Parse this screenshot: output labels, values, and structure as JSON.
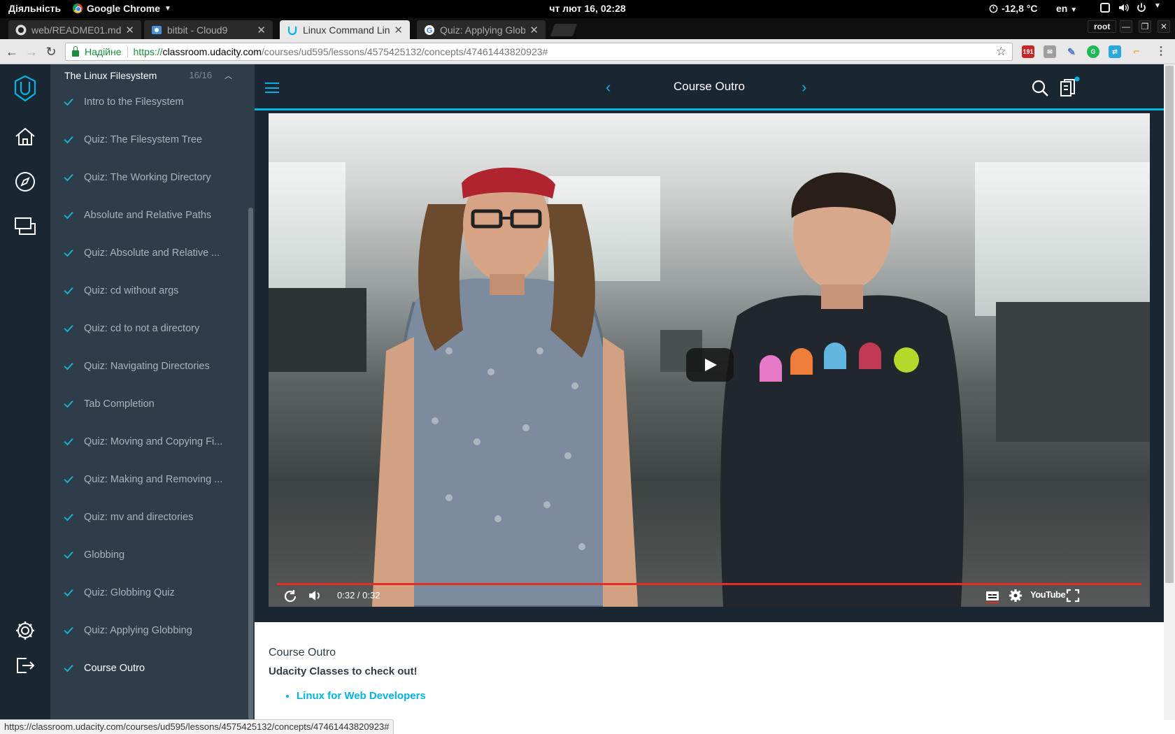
{
  "system_bar": {
    "activities": "Діяльність",
    "app_name": "Google Chrome",
    "clock": "чт лют 16, 02:28",
    "weather": "-12,8 °C",
    "language": "en"
  },
  "browser": {
    "tabs": [
      {
        "title": "web/README01.md",
        "favicon": "github-icon"
      },
      {
        "title": "bitbit - Cloud9",
        "favicon": "cloud9-icon"
      },
      {
        "title": "Linux Command Line",
        "favicon": "udacity-icon",
        "active": true
      },
      {
        "title": "Quiz: Applying Globbing",
        "favicon": "google-icon"
      }
    ],
    "user": "root",
    "secure_label": "Надійне",
    "url_scheme": "https://",
    "url_host": "classroom.udacity.com",
    "url_path": "/courses/ud595/lessons/4575425132/concepts/47461443820923#",
    "extension_badge": "191",
    "status_url": "https://classroom.udacity.com/courses/ud595/lessons/4575425132/concepts/47461443820923#"
  },
  "sidebar": {
    "lesson_title": "The Linux Filesystem",
    "progress": "16/16",
    "items": [
      {
        "label": "Intro to the Filesystem"
      },
      {
        "label": "Quiz: The Filesystem Tree"
      },
      {
        "label": "Quiz: The Working Directory"
      },
      {
        "label": "Absolute and Relative Paths"
      },
      {
        "label": "Quiz: Absolute and Relative ..."
      },
      {
        "label": "Quiz: cd without args"
      },
      {
        "label": "Quiz: cd to not a directory"
      },
      {
        "label": "Quiz: Navigating Directories"
      },
      {
        "label": "Tab Completion"
      },
      {
        "label": "Quiz: Moving and Copying Fi..."
      },
      {
        "label": "Quiz: Making and Removing ..."
      },
      {
        "label": "Quiz: mv and directories"
      },
      {
        "label": "Globbing"
      },
      {
        "label": "Quiz: Globbing Quiz"
      },
      {
        "label": "Quiz: Applying Globbing"
      },
      {
        "label": "Course Outro"
      }
    ]
  },
  "header": {
    "concept_title": "Course Outro"
  },
  "video": {
    "time": "0:32 / 0:32",
    "progress_fraction": 1.0,
    "youtube_label": "YouTube"
  },
  "content": {
    "heading": "Course Outro",
    "subheading": "Udacity Classes to check out!",
    "links": [
      "Linux for Web Developers"
    ]
  },
  "colors": {
    "accent": "#02b3e4",
    "rail": "#1b2633",
    "sidebar": "#2e3d49",
    "progress": "#e52d27"
  }
}
